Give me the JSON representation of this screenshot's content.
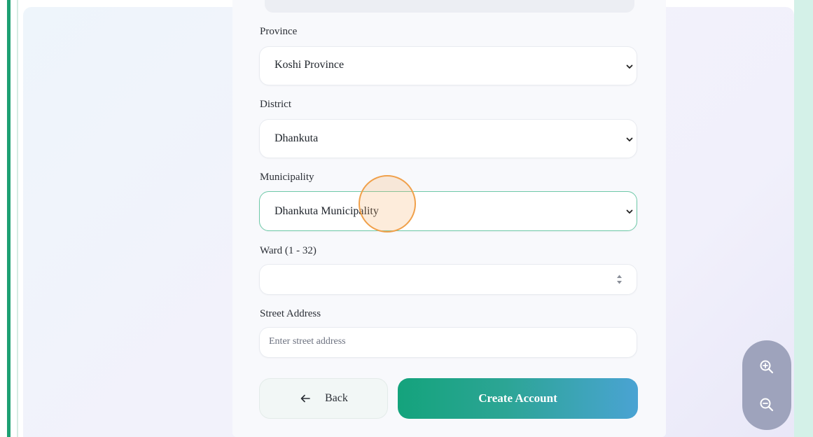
{
  "form": {
    "province": {
      "label": "Province",
      "value": "Koshi Province"
    },
    "district": {
      "label": "District",
      "value": "Dhankuta"
    },
    "municipality": {
      "label": "Municipality",
      "value": "Dhankuta Municipality"
    },
    "ward": {
      "label": "Ward (1 - 32)",
      "value": ""
    },
    "street": {
      "label": "Street Address",
      "placeholder": "Enter street address",
      "value": ""
    }
  },
  "actions": {
    "back_label": "Back",
    "create_label": "Create Account"
  },
  "icons": {
    "back": "arrow-left-icon",
    "zoom_in": "zoom-in-icon",
    "zoom_out": "zoom-out-icon",
    "select": "chevron-down-icon",
    "spinner": "number-spinner-icon"
  },
  "colors": {
    "accent_green": "#1ea073",
    "gradient_start": "#14a37c",
    "gradient_end": "#4aa3d3",
    "focus_border": "#6ec9a8",
    "cursor_highlight": "#f0a04a",
    "zoom_pill": "#9ea3bc"
  }
}
